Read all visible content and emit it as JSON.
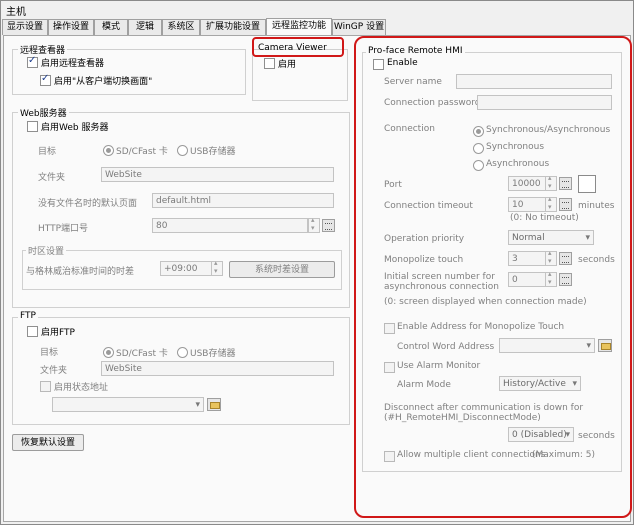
{
  "window": {
    "title": "主机"
  },
  "tabs": [
    "显示设置",
    "操作设置",
    "模式",
    "逻辑",
    "系统区",
    "扩展功能设置",
    "远程监控功能",
    "WinGP 设置"
  ],
  "remote_viewer": {
    "title": "远程查看器",
    "enable_label": "启用远程查看器",
    "enable_switch_label": "启用\"从客户端切换画面\""
  },
  "camera": {
    "title": "Camera Viewer",
    "enable_label": "启用"
  },
  "web": {
    "title": "Web服务器",
    "enable_label": "启用Web 服务器",
    "target_label": "目标",
    "target_options": [
      "SD/CFast 卡",
      "USB存储器"
    ],
    "folder_label": "文件夹",
    "folder_value": "WebSite",
    "default_page_label": "没有文件名时的默认页面",
    "default_page_value": "default.html",
    "port_label": "HTTP端口号",
    "port_value": "80",
    "timezone": {
      "title": "时区设置",
      "offset_label": "与格林威治标准时间的时差",
      "offset_value": "+09:00",
      "button_label": "系统时差设置"
    }
  },
  "ftp": {
    "title": "FTP",
    "enable_label": "启用FTP",
    "target_label": "目标",
    "target_options": [
      "SD/CFast 卡",
      "USB存储器"
    ],
    "folder_label": "文件夹",
    "folder_value": "WebSite",
    "status_label": "启用状态地址"
  },
  "restore_button": "恢复默认设置",
  "hmi": {
    "title": "Pro-face Remote HMI",
    "enable_label": "Enable",
    "server_name_label": "Server name",
    "password_label": "Connection password",
    "connection_label": "Connection",
    "connection_options": [
      "Synchronous/Asynchronous",
      "Synchronous",
      "Asynchronous"
    ],
    "port_label": "Port",
    "port_value": "10000",
    "timeout_label": "Connection timeout",
    "timeout_value": "10",
    "timeout_unit": "minutes",
    "timeout_note": "(0: No timeout)",
    "priority_label": "Operation priority",
    "priority_value": "Normal",
    "monopolize_label": "Monopolize touch",
    "monopolize_value": "3",
    "monopolize_unit": "seconds",
    "initial_label_1": "Initial screen number for",
    "initial_label_2": "asynchronous connection",
    "initial_value": "0",
    "initial_note": "(0: screen displayed when connection made)",
    "enable_address_label": "Enable Address for Monopolize Touch",
    "control_word_label": "Control Word Address",
    "alarm_monitor_label": "Use Alarm Monitor",
    "alarm_mode_label": "Alarm Mode",
    "alarm_mode_value": "History/Active",
    "disconnect_label_1": "Disconnect after communication is down for",
    "disconnect_label_2": "(#H_RemoteHMI_DisconnectMode)",
    "disconnect_value": "0 (Disabled)",
    "disconnect_unit": "seconds",
    "multi_label": "Allow multiple client connections",
    "multi_max": "(Maximum: 5)"
  },
  "highlight_color": "#d01818"
}
